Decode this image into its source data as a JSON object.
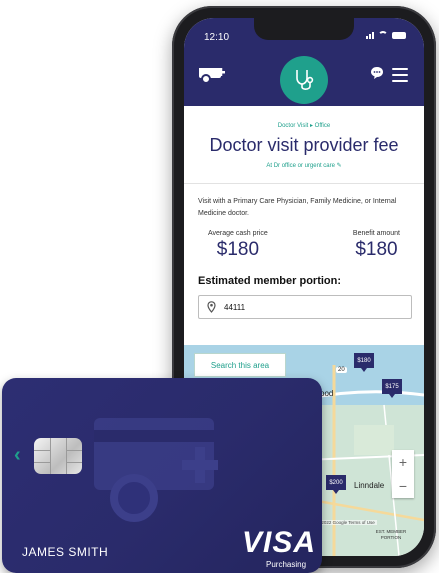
{
  "status_bar": {
    "time": "12:10"
  },
  "page": {
    "breadcrumb": "Doctor Visit ▸ Office",
    "title": "Doctor visit provider fee",
    "subtitle": "At Dr office or urgent care ✎",
    "description": "Visit with a Primary Care Physician, Family Medicine, or Internal Medicine doctor."
  },
  "prices": {
    "average_label": "Average cash price",
    "average_value": "$180",
    "benefit_label": "Benefit amount",
    "benefit_value": "$180"
  },
  "estimate": {
    "heading": "Estimated member portion:",
    "zip_value": "44111"
  },
  "map": {
    "search_button": "Search this area",
    "pins": [
      "$180",
      "$175",
      "$200"
    ],
    "road_label": "20",
    "place_labels": [
      "ood",
      "Linndale"
    ],
    "zoom_in": "+",
    "zoom_out": "−",
    "attribution": "Map data ©2022 Google   Terms of Use",
    "est_member_portion": "EST. MEMBER PORTION"
  },
  "card": {
    "holder_name": "JAMES SMITH",
    "brand": "VISA",
    "brand_sub": "Purchasing"
  },
  "colors": {
    "navy": "#2a2b6b",
    "teal": "#1fa08c"
  }
}
